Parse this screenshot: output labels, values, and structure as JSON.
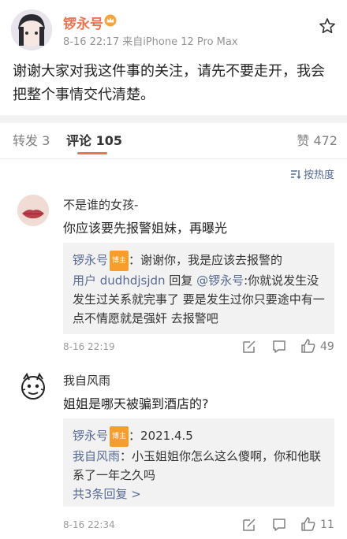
{
  "post": {
    "author": "锣永号",
    "meta": "8-16 22:17  来自iPhone 12 Pro Max",
    "content": "谢谢大家对我这件事的关注，请先不要走开，我会把整个事情交代清楚。"
  },
  "tabs": {
    "repost": "转发 3",
    "comment": "评论 105",
    "like": "赞 472"
  },
  "sort_label": "按热度",
  "comments": [
    {
      "author": "不是谁的女孩-",
      "text": "你应该要先报警姐妹，再曝光",
      "replies": [
        {
          "name": "锣永号",
          "tag": "博主",
          "sep": "：",
          "text": "谢谢你，我是应该去报警的"
        },
        {
          "name": "用户 dudhdjsjdn",
          "mid": " 回复 ",
          "mention": "@锣永号",
          "text": ":你就说发生没发生过关系就完事了 要是发生过你只要途中有一点不情愿就是强奸 去报警吧"
        }
      ],
      "time": "8-16 22:19",
      "likes": "49"
    },
    {
      "author": "我自风雨",
      "text": "姐姐是哪天被骗到酒店的?",
      "replies": [
        {
          "name": "锣永号",
          "tag": "博主",
          "sep": "：",
          "text": "2021.4.5"
        },
        {
          "name": "我自风雨",
          "sep": "：",
          "text": "小玉姐姐你怎么这么傻啊，你和他联系了一年之久吗"
        }
      ],
      "more": "共3条回复 >",
      "time": "8-16 22:34",
      "likes": "11"
    }
  ]
}
